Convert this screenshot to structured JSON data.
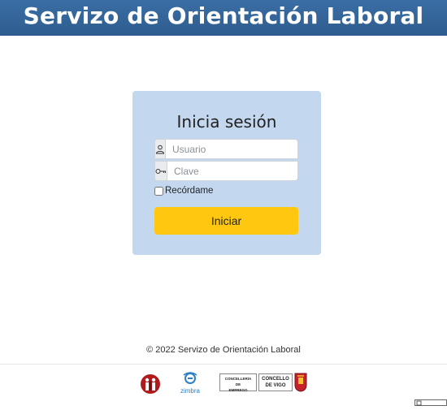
{
  "header": {
    "title": "Servizo de Orientación Laboral"
  },
  "login": {
    "title": "Inicia sesión",
    "username_placeholder": "Usuario",
    "password_placeholder": "Clave",
    "remember_label": "Recórdame",
    "submit_label": "Iniciar"
  },
  "footer": {
    "copyright": "© 2022 Servizo de Orientación Laboral",
    "logos": {
      "zimbra_label": "zimbra",
      "concelleria_line1": "CONCELLERÍA",
      "concelleria_line2": "DE",
      "concelleria_line3": "EMPREGO",
      "concello_line1": "CONCELLO",
      "concello_line2": "DE VIGO"
    }
  },
  "colors": {
    "header_bg": "#3a6ea5",
    "card_bg": "#c3d7ee",
    "button_bg": "#ffc70f"
  },
  "icons": {
    "user": "user-icon",
    "key": "key-icon"
  }
}
